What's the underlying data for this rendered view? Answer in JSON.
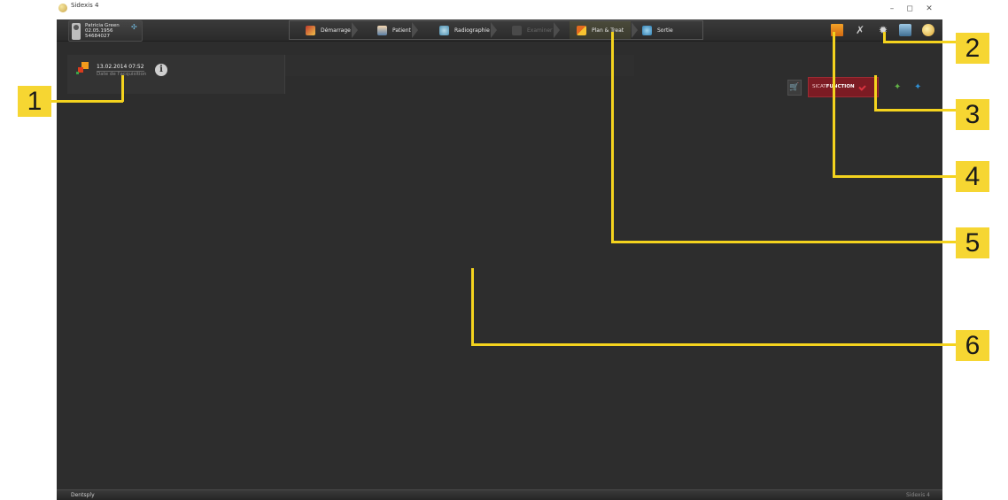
{
  "window": {
    "title": "Sidexis 4",
    "controls": {
      "minimize": "–",
      "maximize": "◻",
      "close": "✕"
    }
  },
  "patient": {
    "name": "Patricia Green",
    "dob": "02.05.1956",
    "id": "54684027",
    "switch_icon": "✣"
  },
  "workflow": {
    "steps": [
      {
        "label": "Démarrage",
        "icon": "start-icon",
        "active": false,
        "enabled": true
      },
      {
        "label": "Patient",
        "icon": "patient-icon",
        "active": false,
        "enabled": true
      },
      {
        "label": "Radiographie",
        "icon": "xray-icon",
        "active": false,
        "enabled": true
      },
      {
        "label": "Examiner",
        "icon": "exam-icon",
        "active": false,
        "enabled": false
      },
      {
        "label": "Plan & Treat",
        "icon": "plan-treat-icon",
        "active": true,
        "enabled": true
      },
      {
        "label": "Sortie",
        "icon": "exit-icon",
        "active": false,
        "enabled": true
      }
    ]
  },
  "toolbar": {
    "xtools_glyph": "✗",
    "gear_glyph": "✹"
  },
  "acquisition": {
    "date": "13.02.2014 07:52",
    "label": "Date de l'acquisition",
    "info_glyph": "i"
  },
  "sicat": {
    "prefix": "SICAT",
    "name": "FUNCTION",
    "cart_glyph": "🛒",
    "green_glyph": "✦",
    "blue_glyph": "✦"
  },
  "footer": {
    "brand": "Dentsply",
    "version": "Sidexis 4"
  },
  "callouts": [
    "1",
    "2",
    "3",
    "4",
    "5",
    "6"
  ],
  "colors": {
    "accent_callout": "#f6d632",
    "background": "#2d2d2d",
    "sicat_red": "#7c1b23"
  }
}
